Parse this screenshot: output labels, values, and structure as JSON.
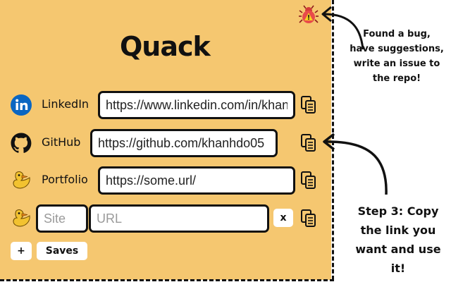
{
  "app": {
    "title": "Quack"
  },
  "links": [
    {
      "label": "LinkedIn",
      "value": "https://www.linkedin.com/in/khan",
      "icon": "linkedin-icon"
    },
    {
      "label": "GitHub",
      "value": "https://github.com/khanhdo05",
      "icon": "github-icon"
    },
    {
      "label": "Portfolio",
      "value": "https://some.url/",
      "icon": "duck-icon"
    }
  ],
  "new_entry": {
    "site_placeholder": "Site",
    "url_placeholder": "URL",
    "remove_label": "x",
    "icon": "duck-icon"
  },
  "footer": {
    "add_label": "+",
    "saves_label": "Saves"
  },
  "annotations": {
    "bug_note": "Found a bug, have suggestions, write an issue to the repo!",
    "step_note": "Step 3: Copy the link you want and use it!"
  },
  "colors": {
    "panel_bg": "#f5c770",
    "linkedin_blue": "#0a66c2",
    "duck_yellow": "#f2c230",
    "duck_orange": "#f08a1c",
    "border": "#111111"
  }
}
